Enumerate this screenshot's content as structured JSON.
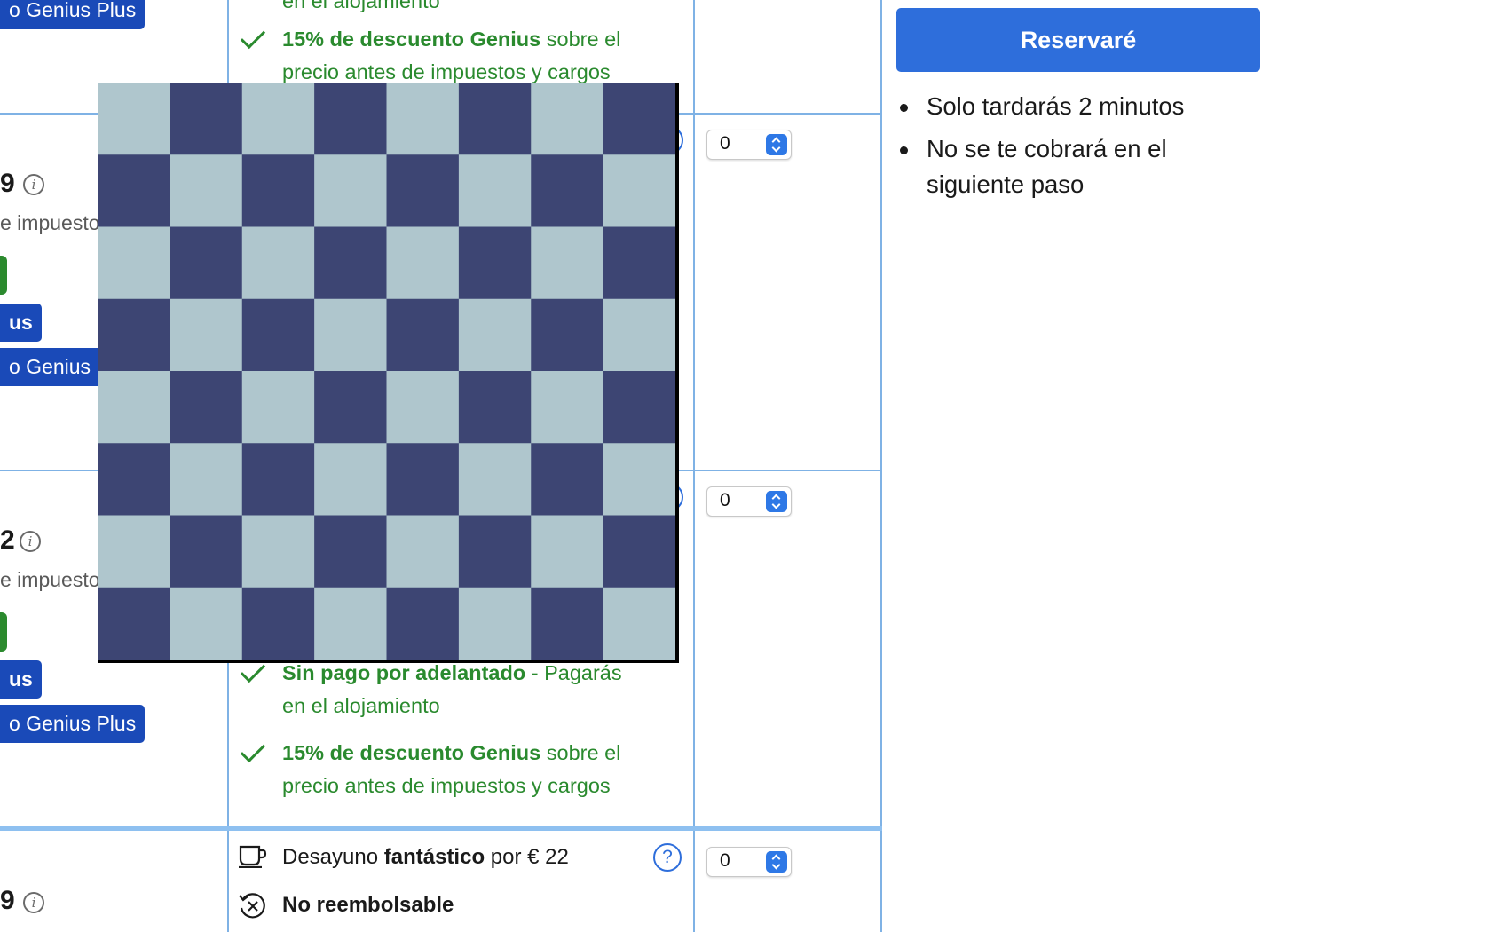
{
  "room_column": {
    "badge_top": "o Genius Plus",
    "rows": [
      {
        "price": "9",
        "tax_note": "e impuesto",
        "short_badge": "us",
        "long_badge": "o Genius P"
      },
      {
        "price": "2",
        "tax_note": "e impuesto",
        "short_badge": "us",
        "long_badge": "o Genius Plus"
      },
      {
        "price": "9"
      }
    ]
  },
  "conditions": {
    "top_cut": "en el alojamiento",
    "discount_bold": "15% de descuento Genius",
    "discount_rest_1": "sobre el",
    "discount_rest_2": "precio antes de impuestos y cargos",
    "no_prepay_bold": "Sin pago por adelantado",
    "no_prepay_rest_1": "- Pagarás",
    "no_prepay_rest_2": "en el alojamiento",
    "breakfast_prefix": "Desayuno",
    "breakfast_bold": "fantástico",
    "breakfast_suffix": "por € 22",
    "non_refundable": "No reembolsable",
    "help_icon_glyph": "?"
  },
  "quantity_selects": [
    {
      "value": "0"
    },
    {
      "value": "0"
    },
    {
      "value": "0"
    }
  ],
  "sidebar": {
    "reserve_label": "Reservaré",
    "notes": [
      "Solo tardarás 2 minutos",
      "No se te cobrará en el siguiente paso"
    ]
  },
  "overlay": {
    "type": "checkerboard",
    "rows": 8,
    "cols": 8,
    "color_light": "#afc6cd",
    "color_dark": "#3d4573"
  },
  "colors": {
    "accent": "#2e6edb",
    "badge": "#1a4ab8",
    "green": "#2a8a2e",
    "table_border": "#7fb2e5"
  },
  "icons": {
    "info": "i",
    "coffee": "coffee-cup-icon",
    "non_refundable": "no-refund-icon"
  }
}
